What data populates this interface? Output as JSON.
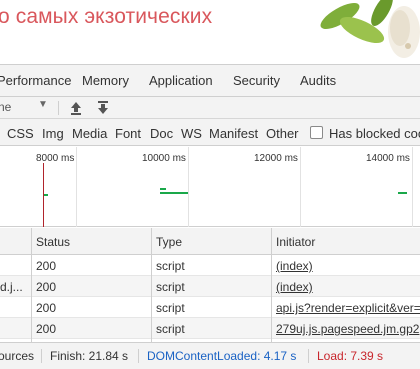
{
  "banner": {
    "text": "о самых экзотических"
  },
  "devtools_tabs": [
    "Performance",
    "Memory",
    "Application",
    "Security",
    "Audits"
  ],
  "toolbar": {
    "throttle_label": "ne"
  },
  "filters": {
    "types": [
      "CSS",
      "Img",
      "Media",
      "Font",
      "Doc",
      "WS",
      "Manifest",
      "Other"
    ],
    "blocked_label": "Has blocked coo"
  },
  "overview": {
    "ticks": [
      "8000 ms",
      "10000 ms",
      "12000 ms",
      "14000 ms"
    ]
  },
  "table": {
    "headers": {
      "name": "",
      "status": "Status",
      "type": "Type",
      "initiator": "Initiator"
    },
    "rows": [
      {
        "name": "",
        "status": "200",
        "type": "script",
        "initiator": "(index)"
      },
      {
        "name": "d.j...",
        "status": "200",
        "type": "script",
        "initiator": "(index)"
      },
      {
        "name": "",
        "status": "200",
        "type": "script",
        "initiator": "api.js?render=explicit&ver="
      },
      {
        "name": "",
        "status": "200",
        "type": "script",
        "initiator": "279uj.js.pagespeed.jm.gp2"
      }
    ]
  },
  "status_bar": {
    "resources": "ources",
    "finish": "Finish: 21.84 s",
    "dcl": "DOMContentLoaded: 4.17 s",
    "load": "Load: 7.39 s"
  },
  "colors": {
    "banner_text": "#d9575c",
    "dcl": "#1a62c4",
    "load": "#c8262c",
    "timeline_bar": "#1aa84a"
  }
}
